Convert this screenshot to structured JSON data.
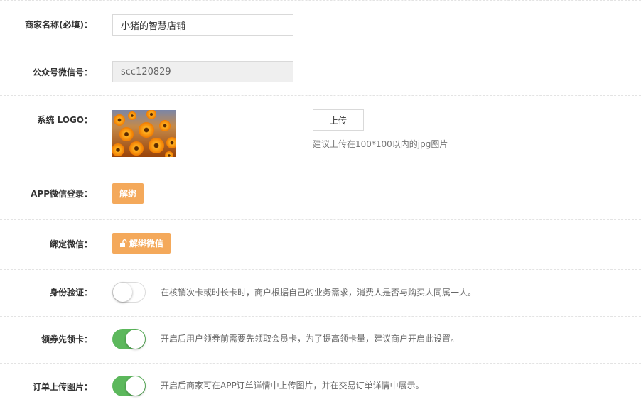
{
  "colors": {
    "accent_orange": "#f4a95b",
    "toggle_on": "#5cb85c",
    "divider": "#e3e3e3"
  },
  "merchant_name": {
    "label": "商家名称(必填)：",
    "value": "小猪的智慧店铺"
  },
  "wechat_account": {
    "label": "公众号微信号：",
    "value": "scc120829"
  },
  "logo": {
    "label": "系统 LOGO：",
    "upload_label": "上传",
    "hint": "建议上传在100*100以内的jpg图片"
  },
  "app_wechat_login": {
    "label": "APP微信登录：",
    "button_label": "解绑"
  },
  "bind_wechat": {
    "label": "绑定微信：",
    "icon": "unlock-icon",
    "button_label": "解绑微信"
  },
  "identity_verify": {
    "label": "身份验证：",
    "enabled": false,
    "description": "在核销次卡或时长卡时，商户根据自己的业务需求，消费人是否与购买人同属一人。"
  },
  "claim_card": {
    "label": "领券先领卡：",
    "enabled": true,
    "description": "开启后用户领券前需要先领取会员卡，为了提高领卡量，建议商户开启此设置。"
  },
  "order_upload": {
    "label": "订单上传图片：",
    "enabled": true,
    "description": "开启后商家可在APP订单详情中上传图片，并在交易订单详情中展示。"
  }
}
